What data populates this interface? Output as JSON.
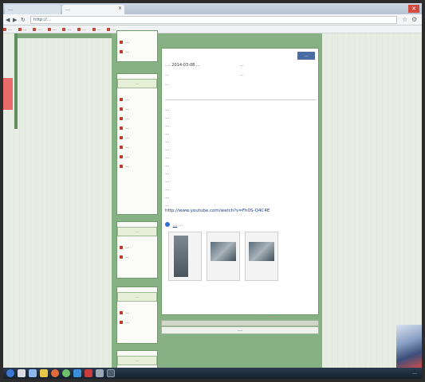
{
  "browser": {
    "tabs": [
      {
        "label": "…"
      },
      {
        "label": "…"
      }
    ],
    "tab_close": "×",
    "window_close": "✕",
    "nav": {
      "back": "◀",
      "forward": "▶",
      "reload": "↻"
    },
    "url": "http://…",
    "bookmarks": [
      "…",
      "…",
      "…",
      "…",
      "…",
      "…",
      "…",
      "…"
    ]
  },
  "sidebar": {
    "top_items": [
      "…",
      "…"
    ],
    "sections": [
      {
        "heading": "…",
        "items": [
          "…",
          "…",
          "…",
          "…",
          "…",
          "…",
          "…",
          "…"
        ]
      },
      {
        "heading": "…",
        "items": [
          "…",
          "…"
        ]
      },
      {
        "heading": "…",
        "items": [
          "…",
          "…"
        ]
      },
      {
        "heading": "…",
        "items": []
      }
    ]
  },
  "post": {
    "print_label": "…",
    "meta": {
      "left_1": "…: 2014-03-08 …",
      "left_2": "…",
      "left_3": "…",
      "right_1": "…",
      "right_2": "…"
    },
    "body_lines": [
      "…",
      "…",
      "…",
      "…",
      "…",
      "…",
      "…",
      "…",
      "…",
      "…",
      "…",
      "…",
      "…"
    ],
    "link": "http://www.youtube.com/watch?v=Fh0S-Q4C4E",
    "attachment": {
      "name": "…",
      "suffix": "…"
    },
    "reply_links": "…",
    "reply_input_label": "…"
  },
  "taskbar": {
    "clock": "…"
  },
  "colors": {
    "page_green": "#87b184",
    "panel_border": "#6f9a6c",
    "bullet_red": "#c13a32",
    "link_blue": "#1a3e8c",
    "taskbar": "#16202c"
  }
}
